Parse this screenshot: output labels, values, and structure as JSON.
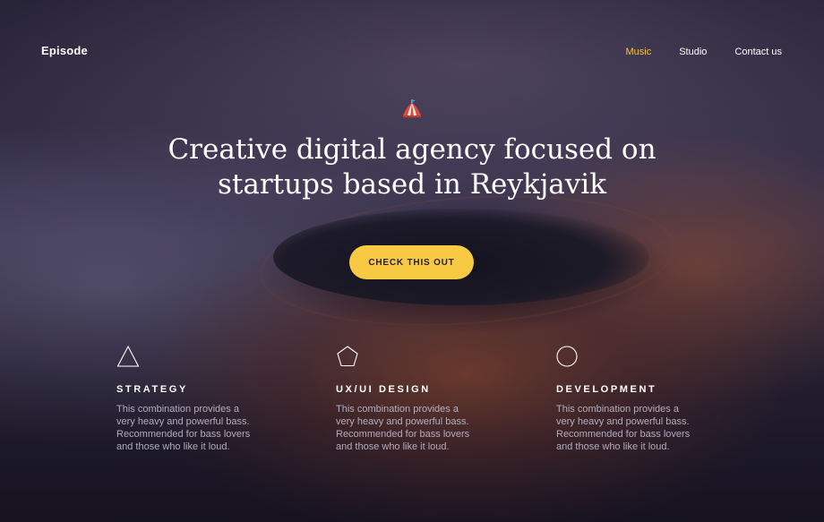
{
  "brand": "Episode",
  "nav": {
    "items": [
      {
        "label": "Music",
        "active": true
      },
      {
        "label": "Studio",
        "active": false
      },
      {
        "label": "Contact us",
        "active": false
      }
    ]
  },
  "hero": {
    "logo_icon": "tent-icon",
    "headline_line1": "Creative digital agency focused on",
    "headline_line2": "startups based in Reykjavik",
    "cta_label": "CHECK THIS OUT"
  },
  "features": [
    {
      "icon": "triangle-icon",
      "title": "STRATEGY",
      "text_line1": "This combination provides a",
      "text_line2": "very heavy and powerful bass.",
      "text_line3": "Recommended for bass lovers",
      "text_line4": "and those who like it loud."
    },
    {
      "icon": "pentagon-icon",
      "title": "UX/UI DESIGN",
      "text_line1": "This combination provides a",
      "text_line2": "very heavy and powerful bass.",
      "text_line3": "Recommended for bass lovers",
      "text_line4": "and those who like it loud."
    },
    {
      "icon": "circle-icon",
      "title": "DEVELOPMENT",
      "text_line1": "This combination provides a",
      "text_line2": "very heavy and powerful bass.",
      "text_line3": "Recommended for bass lovers",
      "text_line4": "and those who like it loud."
    }
  ],
  "colors": {
    "accent": "#f8ca44",
    "nav_active": "#f5c542"
  }
}
